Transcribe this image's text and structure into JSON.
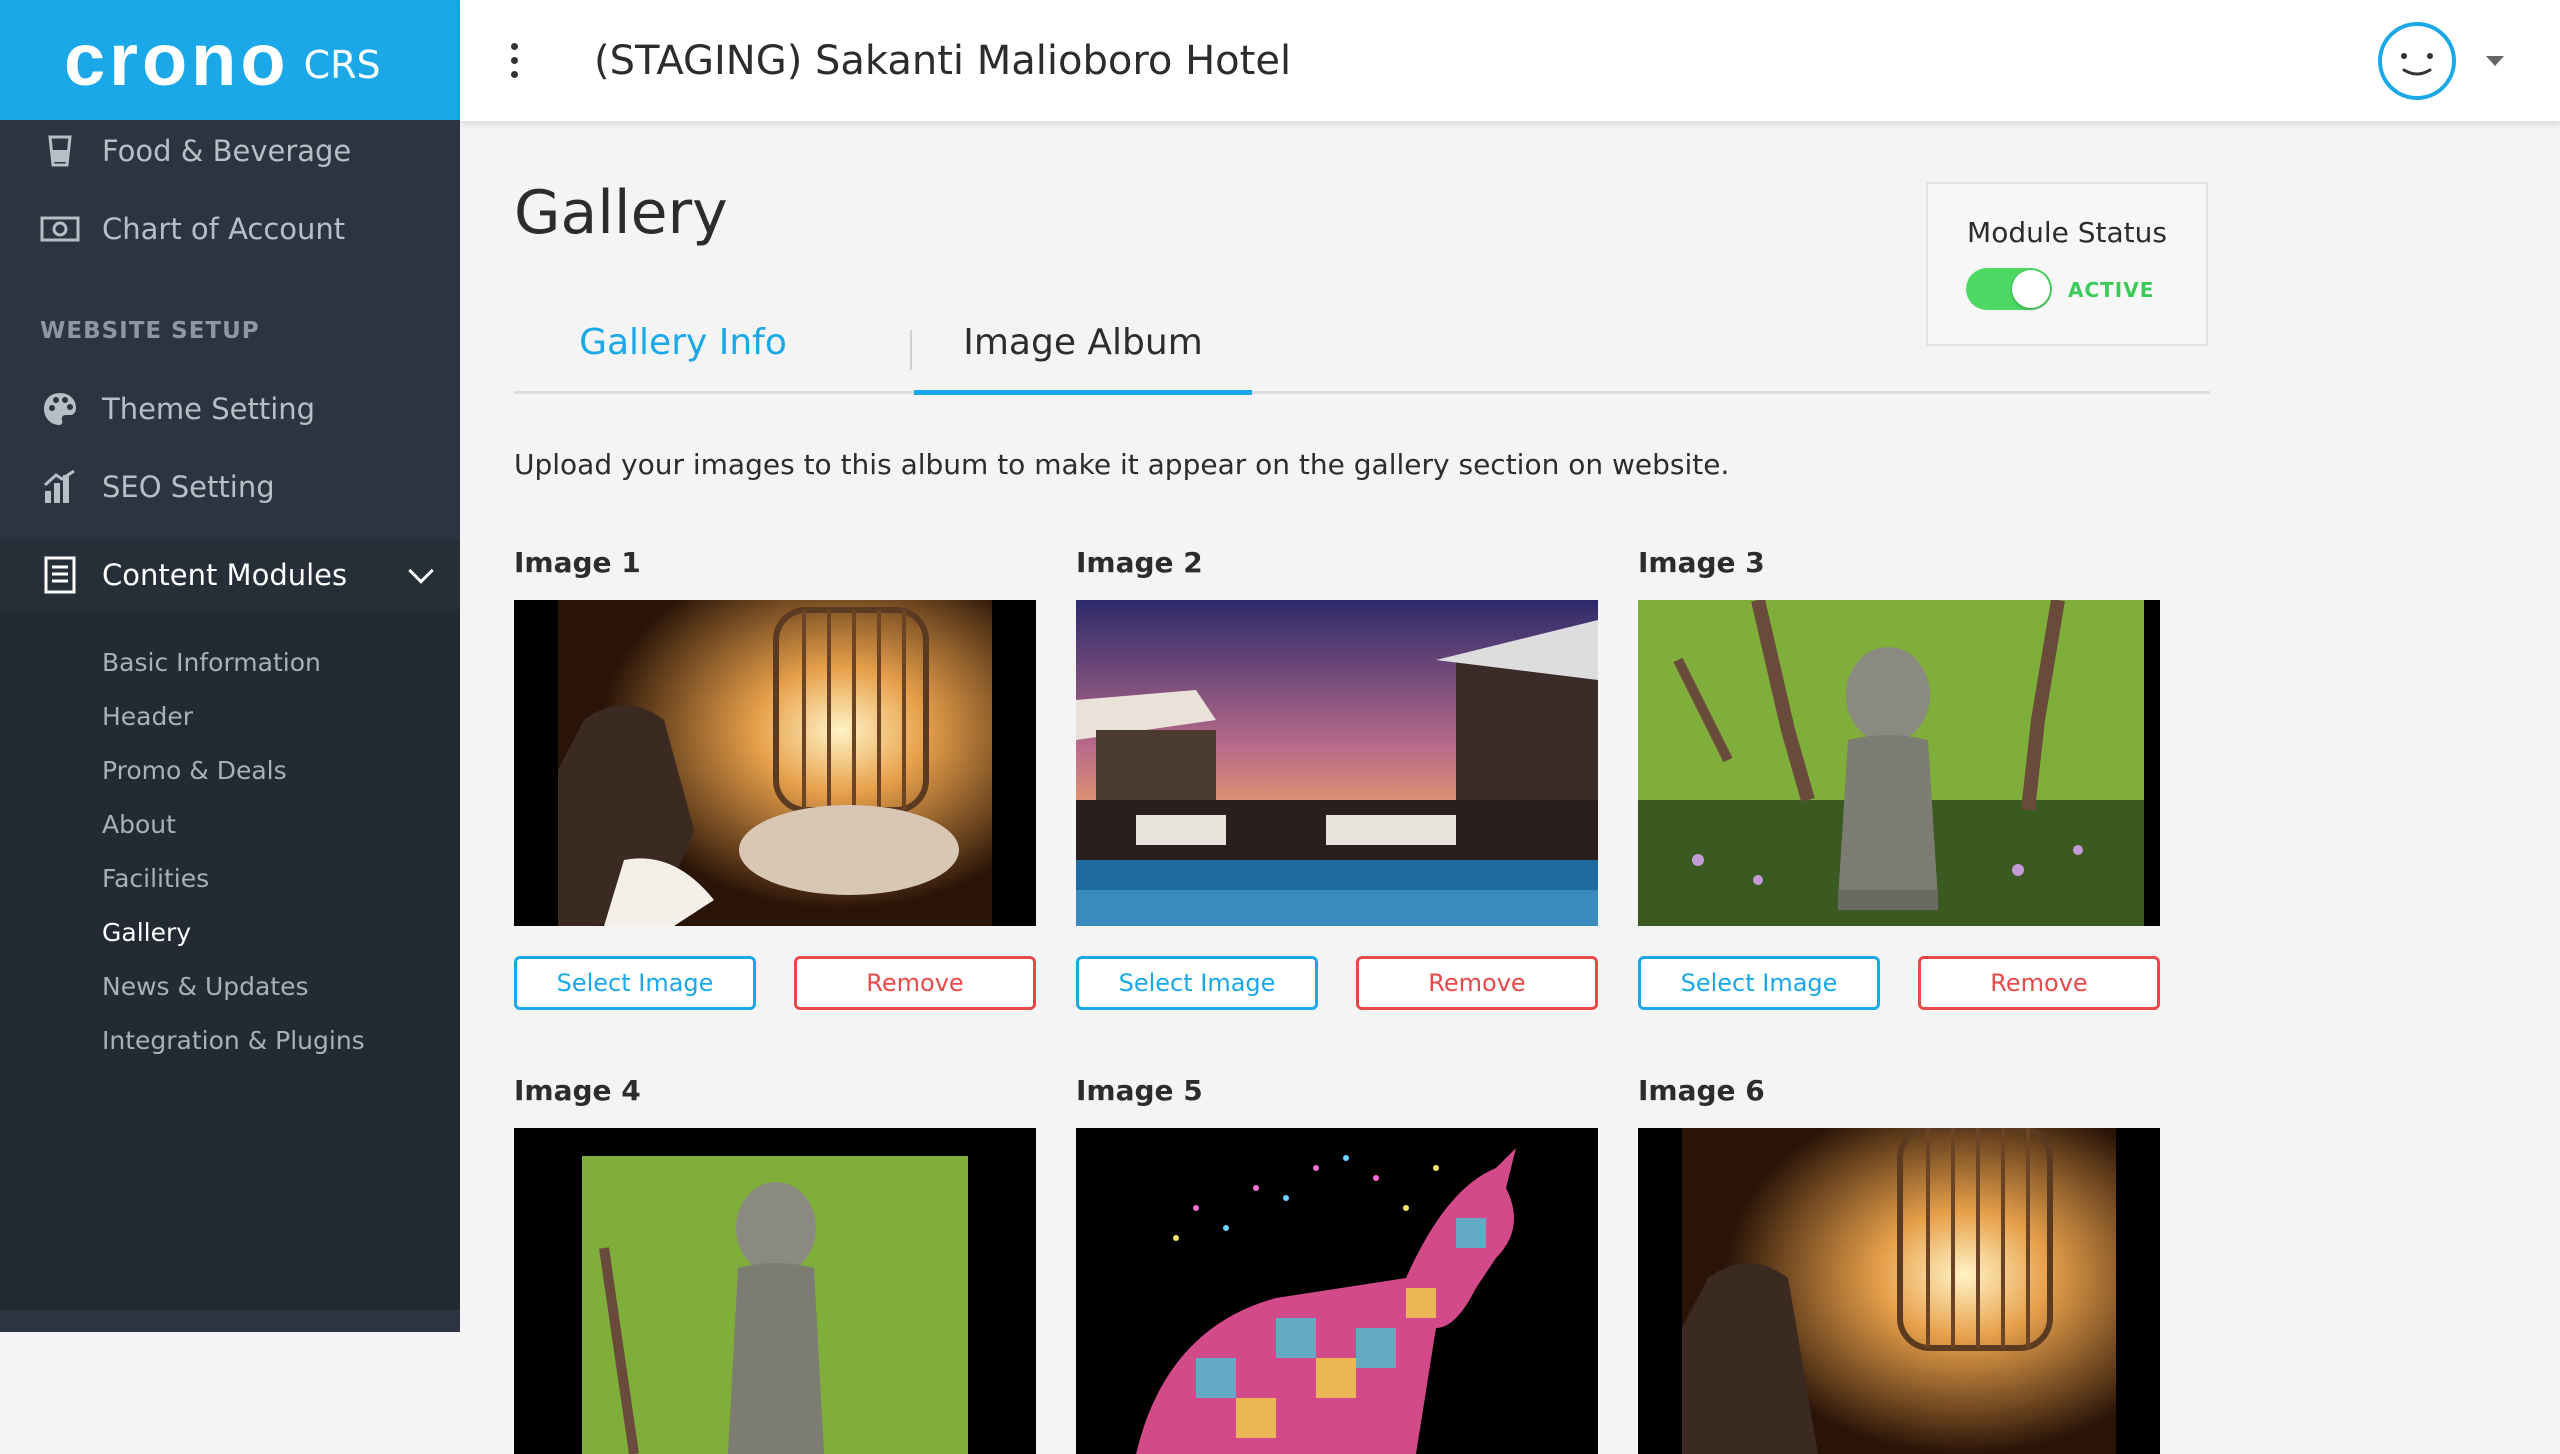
{
  "brand": {
    "logo_word": "crono",
    "logo_suffix": "CRS"
  },
  "header": {
    "hotel_name": "(STAGING) Sakanti Malioboro Hotel"
  },
  "sidebar": {
    "items_top": [
      {
        "label": "Food & Beverage",
        "icon": "glass-icon"
      },
      {
        "label": "Chart of Account",
        "icon": "money-icon"
      }
    ],
    "section_label": "WEBSITE SETUP",
    "items_setup": [
      {
        "label": "Theme Setting",
        "icon": "palette-icon"
      },
      {
        "label": "SEO Setting",
        "icon": "bar-chart-icon"
      },
      {
        "label": "Content Modules",
        "icon": "document-icon"
      }
    ],
    "submenu": [
      "Basic Information",
      "Header",
      "Promo & Deals",
      "About",
      "Facilities",
      "Gallery",
      "News & Updates",
      "Integration & Plugins"
    ],
    "active_submenu": "Gallery"
  },
  "page": {
    "title": "Gallery",
    "module_status": {
      "label": "Module Status",
      "state": "ACTIVE"
    },
    "tabs": [
      {
        "label": "Gallery Info",
        "active": false
      },
      {
        "label": "Image Album",
        "active": true
      }
    ],
    "intro": "Upload your images to this album to make it appear on the gallery section on website."
  },
  "gallery": {
    "select_label": "Select Image",
    "remove_label": "Remove",
    "images": [
      {
        "title": "Image 1"
      },
      {
        "title": "Image 2"
      },
      {
        "title": "Image 3"
      },
      {
        "title": "Image 4"
      },
      {
        "title": "Image 5"
      },
      {
        "title": "Image 6"
      }
    ]
  },
  "colors": {
    "brand": "#1aa8e8",
    "sidebar_bg": "#2b3440",
    "toggle_on": "#4cd964",
    "danger": "#e84a4a"
  }
}
